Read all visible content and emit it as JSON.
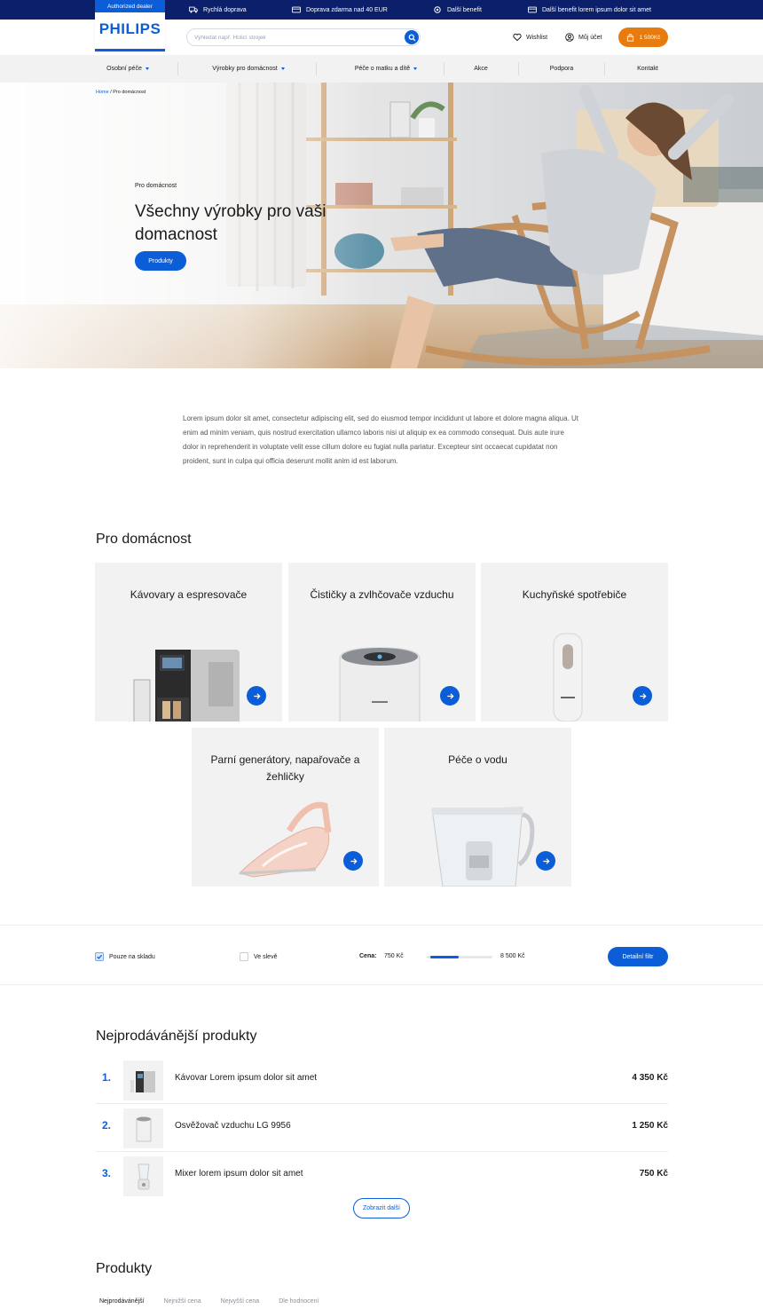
{
  "topbar": {
    "items": [
      {
        "label": "Rychlá doprava",
        "icon": "truck-icon"
      },
      {
        "label": "Doprava zdarma nad 40 EUR",
        "icon": "card-icon"
      },
      {
        "label": "Další benefit",
        "icon": "gear-icon"
      },
      {
        "label": "Další benefit lorem ipsum dolor sit amet",
        "icon": "card-icon"
      }
    ]
  },
  "logo": {
    "dealer": "Authorized dealer",
    "brand": "PHILIPS"
  },
  "header": {
    "search_placeholder": "Vyhledat např. Holicí strojek",
    "wishlist": "Wishlist",
    "account": "Můj účet",
    "cart": "1 500Kč"
  },
  "nav": {
    "items": [
      {
        "label": "Osobní péče",
        "dropdown": true
      },
      {
        "label": "Výrobky pro domácnost",
        "dropdown": true
      },
      {
        "label": "Péče o matku a dítě",
        "dropdown": true
      },
      {
        "label": "Akce",
        "dropdown": false
      },
      {
        "label": "Podpora",
        "dropdown": false
      },
      {
        "label": "Kontakt",
        "dropdown": false
      }
    ]
  },
  "hero": {
    "breadcrumb_home": "Home",
    "breadcrumb_sep": " / ",
    "breadcrumb_current": "Pro domácnost",
    "subtitle": "Pro domácnost",
    "title": "Všechny výrobky pro vaši domacnost",
    "button": "Produkty"
  },
  "intro": {
    "text": "Lorem ipsum dolor sit amet, consectetur adipiscing elit, sed do eiusmod tempor incididunt ut labore et dolore magna aliqua. Ut enim ad minim veniam, quis nostrud exercitation ullamco laboris nisi ut aliquip ex ea commodo consequat. Duis aute irure dolor in reprehenderit in voluptate velit esse cillum dolore eu fugiat nulla pariatur. Excepteur sint occaecat cupidatat non proident, sunt in culpa qui officia deserunt mollit anim id est laborum."
  },
  "categories": {
    "title": "Pro domácnost",
    "items": [
      {
        "label": "Kávovary a espresovače"
      },
      {
        "label": "Čističky a zvlhčovače vzduchu"
      },
      {
        "label": "Kuchyňské spotřebiče"
      },
      {
        "label": "Parní generátory, napařovače a žehličky"
      },
      {
        "label": "Péče o vodu"
      }
    ]
  },
  "filter": {
    "in_stock_label": "Pouze na skladu",
    "in_stock_checked": true,
    "sale_label": "Ve slevě",
    "sale_checked": false,
    "price_label": "Cena:",
    "price_min": "750 Kč",
    "price_max": "8 500 Kč",
    "slider_low_fraction": 0.06,
    "slider_high_fraction": 0.49,
    "button": "Detailní filtr"
  },
  "bestsellers": {
    "title": "Nejprodávánější produkty",
    "rows": [
      {
        "rank": "1.",
        "name": "Kávovar Lorem ipsum dolor sit amet",
        "price": "4 350 Kč"
      },
      {
        "rank": "2.",
        "name": "Osvěžovač vzduchu LG 9956",
        "price": "1 250 Kč"
      },
      {
        "rank": "3.",
        "name": "Mixer lorem ipsum dolor sit amet",
        "price": "750 Kč"
      }
    ],
    "more": "Zobrazit další"
  },
  "products": {
    "title": "Produkty",
    "tabs": [
      "Nejprodávánější",
      "Nejnižší cena",
      "Nejvyšší cena",
      "Dle hodnocení"
    ]
  },
  "colors": {
    "accent": "#0b5ed7",
    "topbar": "#0b1f6b",
    "cart": "#e87b0e"
  }
}
